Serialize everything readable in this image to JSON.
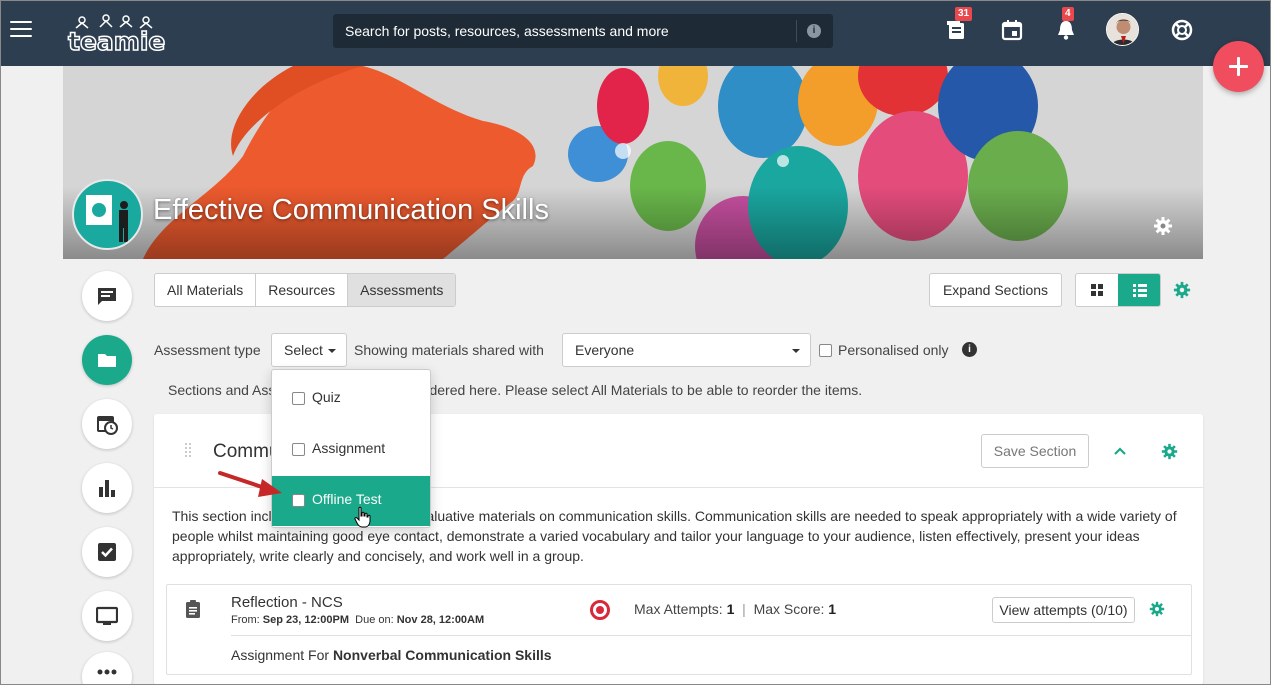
{
  "topbar": {
    "logo_text": "teamie",
    "search_placeholder": "Search for posts, resources, assessments and more",
    "search_info": "i",
    "badges": {
      "notebook": "31",
      "notifications": "4"
    }
  },
  "course": {
    "title": "Effective Communication Skills"
  },
  "filter_tabs": [
    "All Materials",
    "Resources",
    "Assessments"
  ],
  "active_tab": "Assessments",
  "toolbar": {
    "expand_label": "Expand Sections"
  },
  "filters": {
    "assessment_type_label": "Assessment type",
    "select_label": "Select",
    "shared_label": "Showing materials shared with",
    "shared_value": "Everyone",
    "personalised_label": "Personalised only",
    "info": "i"
  },
  "dropdown": {
    "options": [
      "Quiz",
      "Assignment",
      "Offline Test"
    ],
    "highlighted": "Offline Test"
  },
  "notice": "Sections and Assessments cannot be reordered here. Please select All Materials to be able to reorder the items.",
  "section": {
    "title_visible": "Commu",
    "save_label": "Save Section",
    "description": "This section includes instructional and evaluative materials on communication skills. Communication skills are needed to speak appropriately with a wide variety of people whilst maintaining good eye contact, demonstrate a varied vocabulary and tailor your language to your audience, listen effectively, present your ideas appropriately, write clearly and concisely, and work well in a group."
  },
  "item": {
    "title": "Reflection - NCS",
    "from_label": "From:",
    "from_value": "Sep 23, 12:00PM",
    "due_label": "Due on:",
    "due_value": "Nov 28, 12:00AM",
    "max_attempts_label": "Max Attempts:",
    "max_attempts_value": "1",
    "max_score_label": "Max Score:",
    "max_score_value": "1",
    "separator": "|",
    "view_attempts": "View attempts (0/10)",
    "assignment_prefix": "Assignment For",
    "assignment_target": "Nonverbal Communication Skills"
  },
  "colors": {
    "topbar": "#2d3e50",
    "accent": "#1aa98b",
    "fab": "#f04e5e",
    "badge": "#e9484d",
    "status": "#d9283c"
  }
}
